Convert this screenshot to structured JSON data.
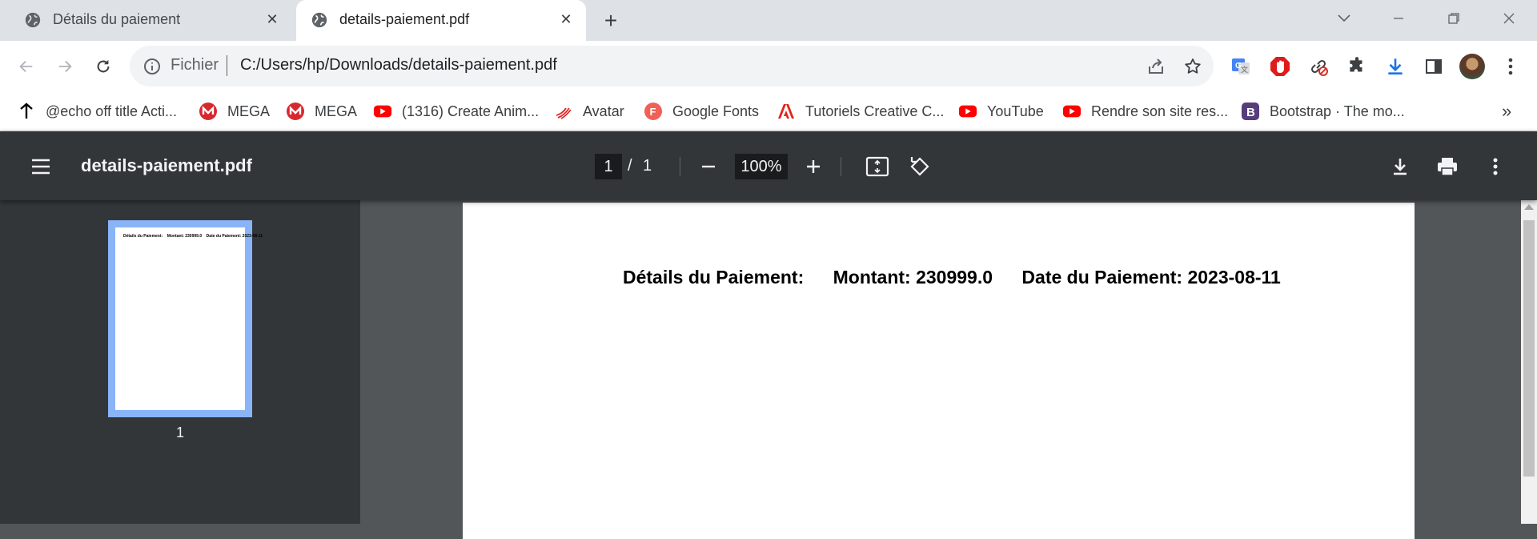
{
  "tabs": [
    {
      "title": "Détails du paiement",
      "active": false
    },
    {
      "title": "details-paiement.pdf",
      "active": true
    }
  ],
  "address_bar": {
    "scheme_label": "Fichier",
    "url": "C:/Users/hp/Downloads/details-paiement.pdf"
  },
  "bookmarks": [
    {
      "label": "@echo off title Acti...",
      "icon": "pin-icon"
    },
    {
      "label": "MEGA",
      "icon": "mega-icon"
    },
    {
      "label": "MEGA",
      "icon": "mega-icon"
    },
    {
      "label": "(1316) Create Anim...",
      "icon": "youtube-icon"
    },
    {
      "label": "Avatar",
      "icon": "avatar-logo-icon"
    },
    {
      "label": "Google Fonts",
      "icon": "google-fonts-icon"
    },
    {
      "label": "Tutoriels Creative C...",
      "icon": "adobe-icon"
    },
    {
      "label": "YouTube",
      "icon": "youtube-icon"
    },
    {
      "label": "Rendre son site res...",
      "icon": "youtube-icon"
    },
    {
      "label": "Bootstrap · The mo...",
      "icon": "bootstrap-icon"
    }
  ],
  "pdf_viewer": {
    "file_name": "details-paiement.pdf",
    "current_page": "1",
    "page_separator": "/",
    "total_pages": "1",
    "zoom": "100%",
    "thumbnail_label": "1"
  },
  "document": {
    "line": [
      "Détails du Paiement:",
      "Montant: 230999.0",
      "Date du Paiement: 2023-08-11"
    ]
  },
  "colors": {
    "tabstrip": "#dee1e6",
    "pdf_toolbar": "#323639",
    "pdf_background": "#525659",
    "thumbnail_highlight": "#8ab4f8"
  }
}
